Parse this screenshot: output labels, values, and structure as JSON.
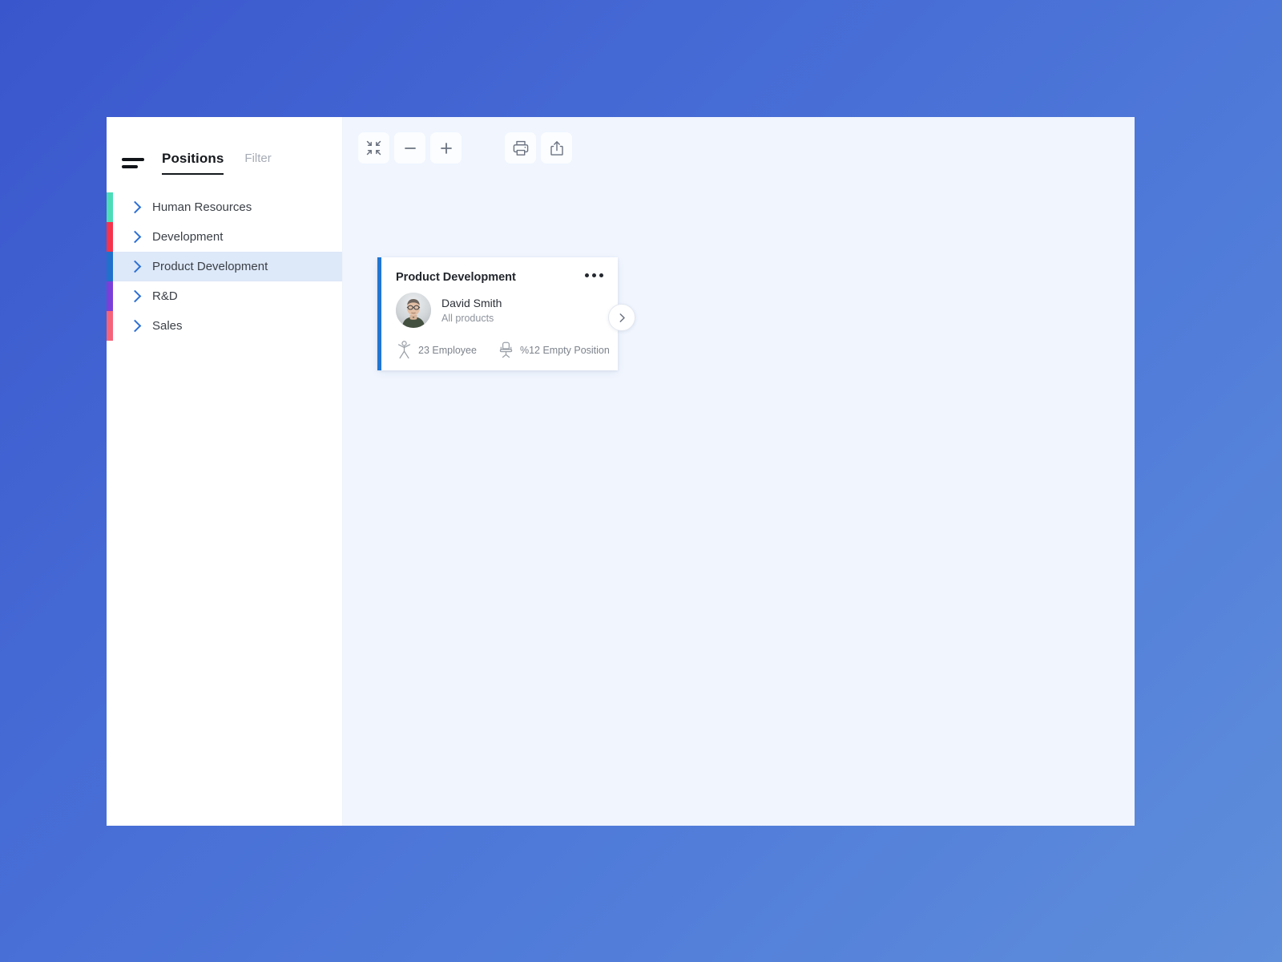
{
  "window": {
    "background_gradient_from": "#3a56cc",
    "background_gradient_to": "#5f8edb",
    "canvas_bg": "#f0f5fe"
  },
  "sidebar": {
    "menu_icon": "hamburger-icon",
    "tabs": [
      {
        "label": "Positions",
        "active": true
      },
      {
        "label": "Filter",
        "active": false
      }
    ],
    "departments": [
      {
        "label": "Human Resources",
        "color": "#4cddb8",
        "selected": false,
        "chevron": "chevron-right-icon"
      },
      {
        "label": "Development",
        "color": "#f5334c",
        "selected": false,
        "chevron": "chevron-right-icon"
      },
      {
        "label": "Product Development",
        "color": "#2070cc",
        "selected": true,
        "chevron": "chevron-right-icon"
      },
      {
        "label": "R&D",
        "color": "#7b3fd9",
        "selected": false,
        "chevron": "chevron-right-icon"
      },
      {
        "label": "Sales",
        "color": "#f5637a",
        "selected": false,
        "chevron": "chevron-right-icon"
      }
    ]
  },
  "toolbar": {
    "buttons": [
      {
        "name": "fit-to-screen-button",
        "icon": "collapse-arrows-icon",
        "label": "Fit to screen"
      },
      {
        "name": "zoom-out-button",
        "icon": "minus-icon",
        "label": "Zoom out"
      },
      {
        "name": "zoom-in-button",
        "icon": "plus-icon",
        "label": "Zoom in"
      },
      {
        "name": "print-button",
        "icon": "printer-icon",
        "label": "Print"
      },
      {
        "name": "share-button",
        "icon": "share-upload-icon",
        "label": "Share"
      }
    ]
  },
  "card": {
    "title": "Product Development",
    "accent_color": "#2176d2",
    "menu_icon": "more-options-icon",
    "person": {
      "avatar": "user-photo-avatar",
      "name": "David Smith",
      "subtitle": "All products"
    },
    "stats": [
      {
        "icon": "person-raised-arms-icon",
        "text": "23 Employee"
      },
      {
        "icon": "office-chair-icon",
        "text": "%12 Empty Position"
      }
    ],
    "expand_icon": "chevron-right-icon"
  }
}
